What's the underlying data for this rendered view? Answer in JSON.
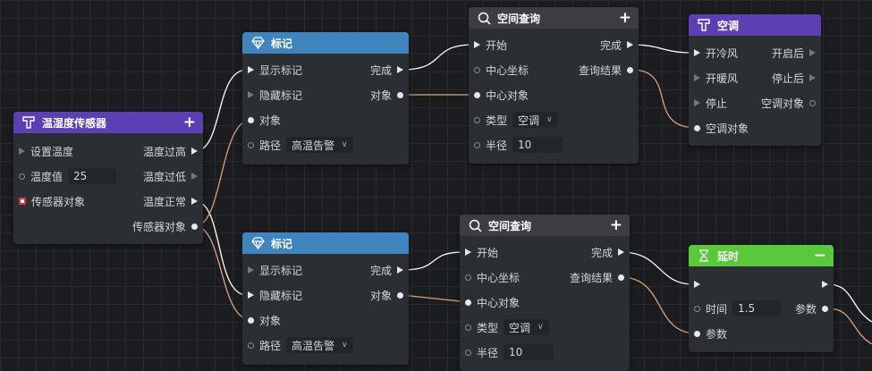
{
  "nodes": {
    "sensor": {
      "title": "温湿度传感器",
      "tool": "+",
      "inputs": [
        "设置温度",
        "温度值",
        "传感器对象"
      ],
      "temp_value": "25",
      "outputs": [
        "温度过高",
        "温度过低",
        "温度正常",
        "传感器对象"
      ]
    },
    "mark1": {
      "title": "标记",
      "inputs": [
        "显示标记",
        "隐藏标记",
        "对象",
        "路径"
      ],
      "path_value": "高温告警",
      "outputs": [
        "完成",
        "对象"
      ]
    },
    "mark2": {
      "title": "标记",
      "inputs": [
        "显示标记",
        "隐藏标记",
        "对象",
        "路径"
      ],
      "path_value": "高温告警",
      "outputs": [
        "完成",
        "对象"
      ]
    },
    "query1": {
      "title": "空间查询",
      "tool": "+",
      "inputs": [
        "开始",
        "中心坐标",
        "中心对象",
        "类型",
        "半径"
      ],
      "type_value": "空调",
      "radius_value": "10",
      "outputs": [
        "完成",
        "查询结果"
      ]
    },
    "query2": {
      "title": "空间查询",
      "tool": "+",
      "inputs": [
        "开始",
        "中心坐标",
        "中心对象",
        "类型",
        "半径"
      ],
      "type_value": "空调",
      "radius_value": "10",
      "outputs": [
        "完成",
        "查询结果"
      ]
    },
    "ac": {
      "title": "空调",
      "inputs": [
        "开冷风",
        "开暖风",
        "停止",
        "空调对象"
      ],
      "outputs": [
        "开启后",
        "停止后",
        "空调对象"
      ]
    },
    "delay": {
      "title": "延时",
      "tool": "−",
      "inputs": [
        "时间",
        "参数"
      ],
      "time_value": "1.5",
      "outputs": [
        "参数"
      ]
    }
  },
  "colors": {
    "header_purple": "#5b3fb3",
    "header_blue": "#3f84bd",
    "header_dark": "#3b3d43",
    "header_green": "#59c93b",
    "exec_wire": "#ffffff",
    "data_wire": "#d9a37e",
    "pin_red": "#e0324b"
  },
  "icons": {
    "sensor": "sensor-icon",
    "mark": "diamond-icon",
    "query": "search-icon",
    "ac": "ac-icon",
    "delay": "hourglass-icon"
  }
}
